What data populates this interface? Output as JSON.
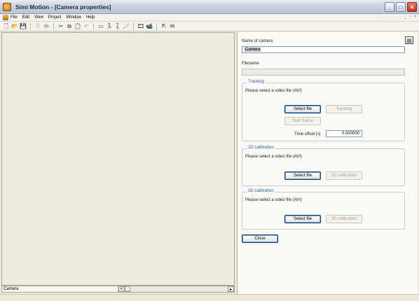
{
  "window": {
    "title": "Simi Motion - [Camera properties]",
    "controls": {
      "minimize": "_",
      "maximize": "□",
      "close": "✕"
    }
  },
  "menu": {
    "items": [
      "File",
      "Edit",
      "View",
      "Project",
      "Window",
      "Help"
    ],
    "mdi": {
      "minimize": "_",
      "restore": "▫",
      "close": "×"
    }
  },
  "toolbar": {
    "icons": [
      {
        "name": "new-file-icon",
        "glyph": "🗋"
      },
      {
        "name": "open-folder-icon",
        "glyph": "📂"
      },
      {
        "name": "save-icon",
        "glyph": "💾"
      },
      {
        "name": "print-preview-icon",
        "glyph": "🖹"
      },
      {
        "name": "print-icon",
        "glyph": "🖶"
      },
      {
        "name": "cut-icon",
        "glyph": "✂"
      },
      {
        "name": "copy-icon",
        "glyph": "⧉"
      },
      {
        "name": "paste-icon",
        "glyph": "📋"
      },
      {
        "name": "undo-icon",
        "glyph": "↶"
      },
      {
        "name": "window-icon",
        "glyph": "▭"
      },
      {
        "name": "person-run-icon",
        "glyph": "🏃"
      },
      {
        "name": "person-stand-icon",
        "glyph": "🚶"
      },
      {
        "name": "graph-icon",
        "glyph": "📈"
      },
      {
        "name": "video-icon",
        "glyph": "🎞"
      },
      {
        "name": "camera-icon",
        "glyph": "📹"
      },
      {
        "name": "help-pointer-icon",
        "glyph": "⇱"
      },
      {
        "name": "envelope-icon",
        "glyph": "✉"
      }
    ]
  },
  "left": {
    "status_label": "Camera",
    "scroll_left": "<"
  },
  "properties": {
    "name_label": "Name of camera",
    "name_value": "Camera",
    "filename_label": "Filename",
    "filename_value": "",
    "tracking": {
      "title": "Tracking",
      "hint": "Please select a video file (AVI)",
      "select_btn": "Select file",
      "tracking_btn": "Tracking",
      "start_frame_btn": "Start frame",
      "time_offset_label": "Time offset [s]",
      "time_offset_value": "0,000000"
    },
    "cal2d": {
      "title": "2D calibration",
      "hint": "Please select a video file (AVI)",
      "select_btn": "Select file",
      "calib_btn": "2D calibration"
    },
    "cal3d": {
      "title": "3D calibration",
      "hint": "Please select a video file (AVI)",
      "select_btn": "Select file",
      "calib_btn": "3D calibration"
    },
    "close_btn": "Close"
  }
}
